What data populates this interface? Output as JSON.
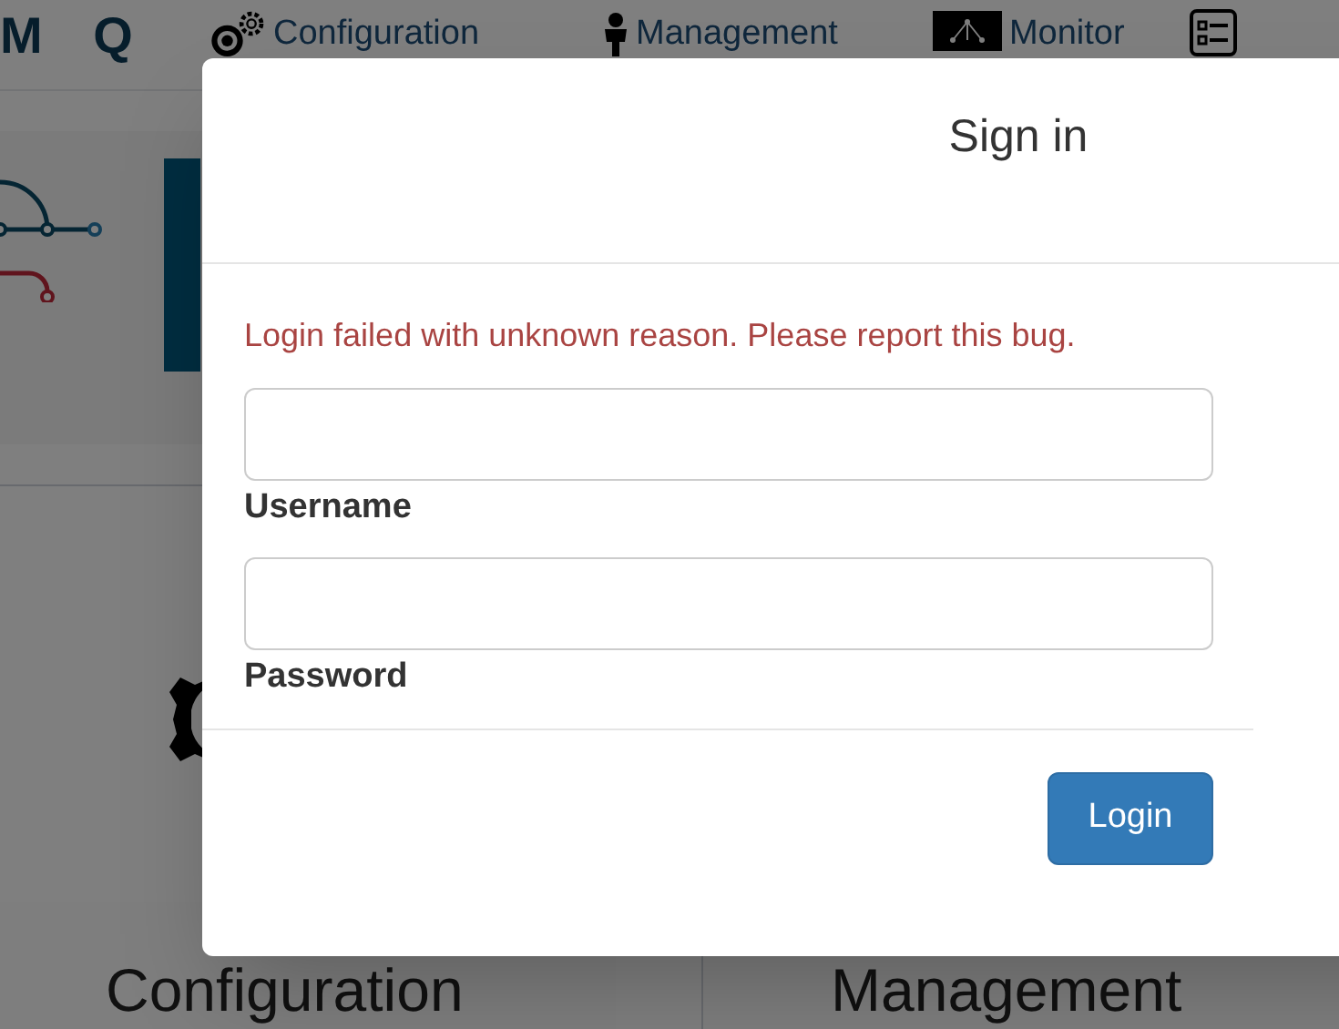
{
  "nav": {
    "logo": "M Q",
    "items": [
      {
        "label": "Configuration"
      },
      {
        "label": "Management"
      },
      {
        "label": "Monitor"
      }
    ]
  },
  "tiles": [
    {
      "label": "Configuration"
    },
    {
      "label": "Management"
    }
  ],
  "dialog": {
    "title": "Sign in",
    "error": "Login failed with unknown reason. Please report this bug.",
    "fields": [
      {
        "label": "Username"
      },
      {
        "label": "Password"
      }
    ],
    "buttons": [
      "Login"
    ]
  }
}
